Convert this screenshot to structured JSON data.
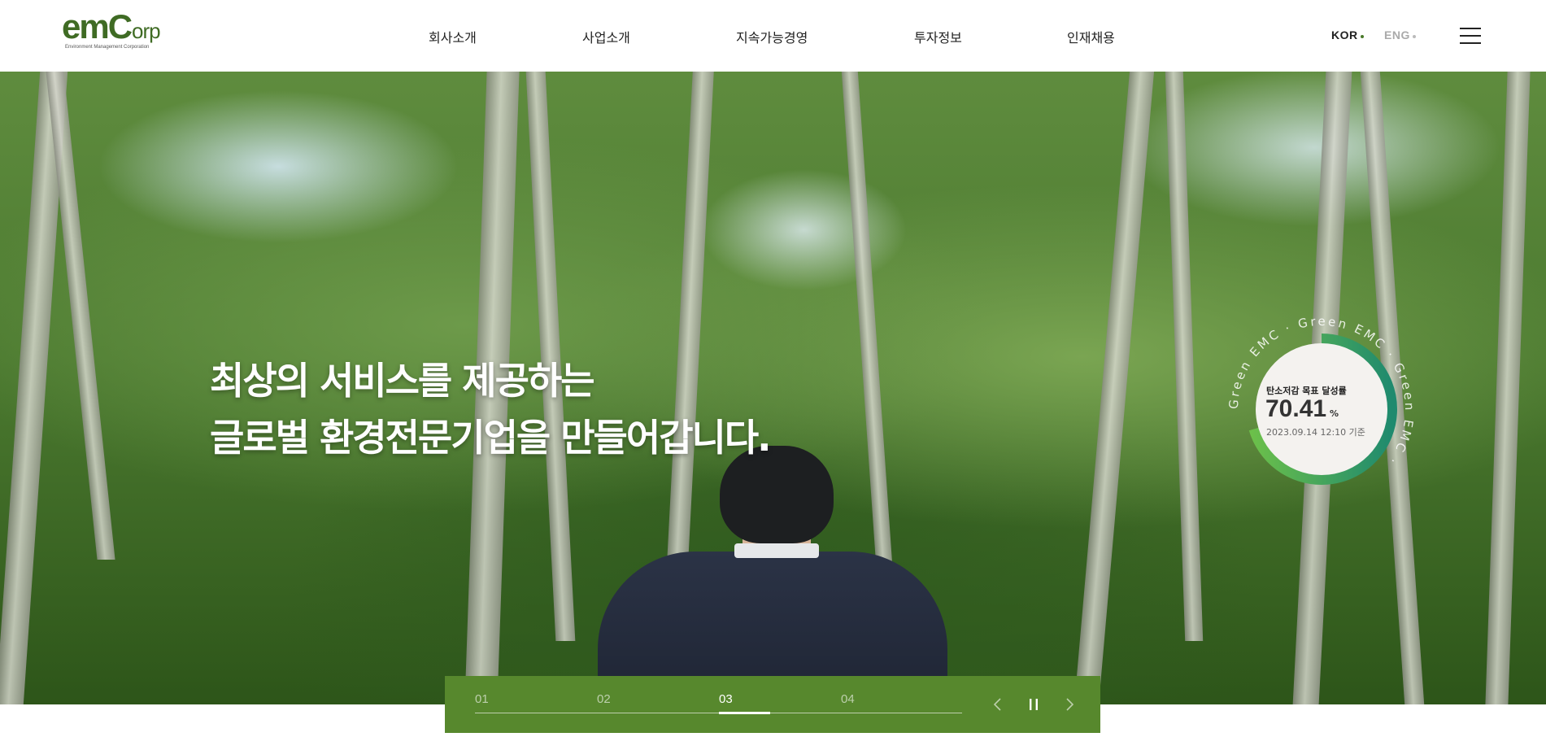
{
  "header": {
    "logo": {
      "main": "emC",
      "sub": "orp",
      "tagline": "Environment Management Corporation"
    },
    "nav": [
      {
        "label": "회사소개"
      },
      {
        "label": "사업소개"
      },
      {
        "label": "지속가능경영"
      },
      {
        "label": "투자정보"
      },
      {
        "label": "인재채용"
      }
    ],
    "languages": [
      {
        "label": "KOR",
        "active": true
      },
      {
        "label": "ENG",
        "active": false
      }
    ],
    "menu_icon": "hamburger-menu-icon"
  },
  "hero": {
    "title_line1": "최상의 서비스를 제공하는",
    "title_line2": "글로벌 환경전문기업을 만들어갑니다."
  },
  "carbon_badge": {
    "label": "탄소저감 목표 달성률",
    "value": "70.41",
    "unit": "%",
    "date": "2023.09.14 12:10 기준",
    "ring_text": "Green EMC · Green EMC · Green EMC ·",
    "progress_fraction": 0.7041,
    "ring_colors": [
      "#6cc04a",
      "#1f8a6e"
    ]
  },
  "slider": {
    "slides": [
      "01",
      "02",
      "03",
      "04"
    ],
    "active_index": 2,
    "prev_icon": "chevron-left-icon",
    "pause_icon": "pause-icon",
    "next_icon": "chevron-right-icon",
    "bar_color": "#57882d"
  }
}
